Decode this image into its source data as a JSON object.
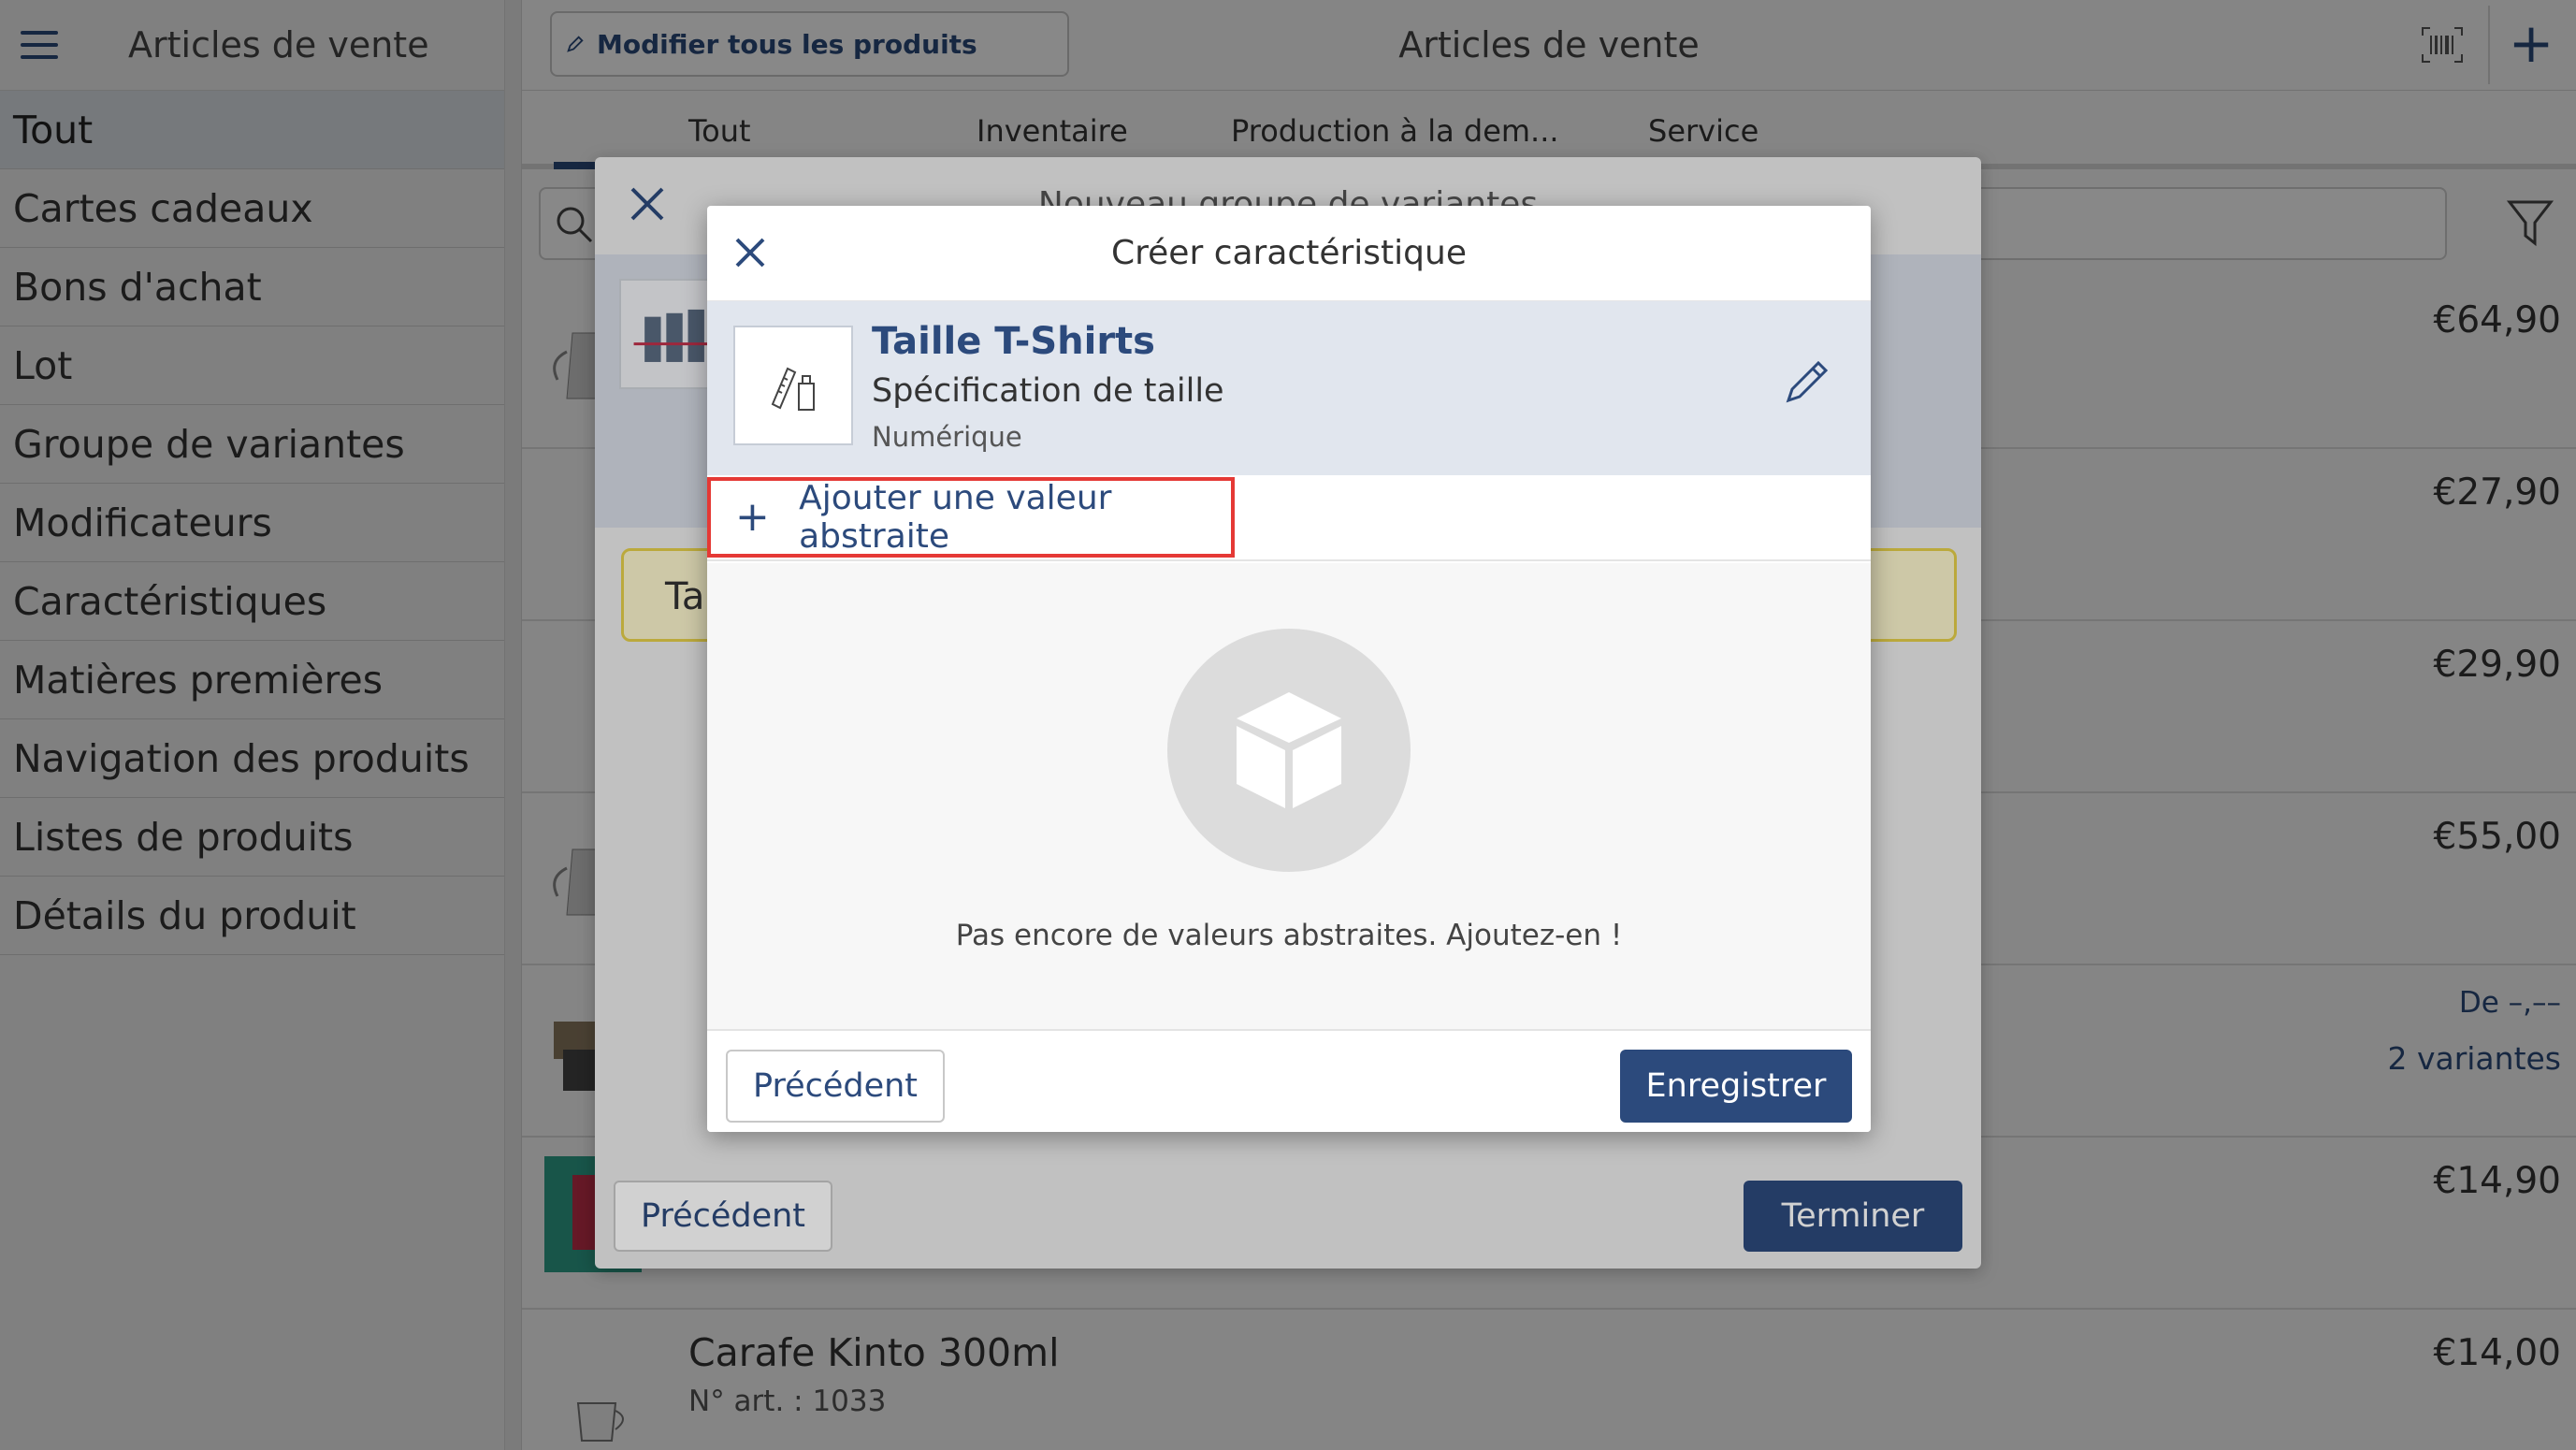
{
  "sidebar": {
    "title": "Articles de vente",
    "items": [
      {
        "label": "Tout"
      },
      {
        "label": "Cartes cadeaux"
      },
      {
        "label": "Bons d'achat"
      },
      {
        "label": "Lot"
      },
      {
        "label": "Groupe de variantes"
      },
      {
        "label": "Modificateurs"
      },
      {
        "label": "Caractéristiques"
      },
      {
        "label": "Matières premières"
      },
      {
        "label": "Navigation des produits"
      },
      {
        "label": "Listes de produits"
      },
      {
        "label": "Détails du produit"
      }
    ]
  },
  "topbar": {
    "edit_all_label": "Modifier tous les produits",
    "title": "Articles de vente",
    "add_label": "+"
  },
  "tabs": [
    {
      "label": "Tout"
    },
    {
      "label": "Inventaire"
    },
    {
      "label": "Production à la dem..."
    },
    {
      "label": "Service"
    }
  ],
  "products": [
    {
      "price": "€64,90"
    },
    {
      "price": "€27,90"
    },
    {
      "price": "€29,90"
    },
    {
      "price": "€55,00"
    },
    {
      "price_from": "De –,––",
      "variants": "2 variantes"
    },
    {
      "price": "€14,90"
    },
    {
      "name": "Carafe Kinto 300ml",
      "art_no": "N° art. : 1033",
      "price": "€14,00"
    }
  ],
  "variant_dialog": {
    "title": "Nouveau groupe de variantes",
    "yellow_text": "Tai",
    "prev_label": "Précédent",
    "finish_label": "Terminer"
  },
  "dialog": {
    "title": "Créer caractéristique",
    "characteristic": {
      "name": "Taille T-Shirts",
      "description": "Spécification de taille",
      "type": "Numérique"
    },
    "add_value_label": "Ajouter une valeur abstraite",
    "empty_text": "Pas encore de valeurs abstraites. Ajoutez-en !",
    "prev_label": "Précédent",
    "save_label": "Enregistrer"
  },
  "colors": {
    "accent": "#2c4a7c",
    "highlight": "#e53935",
    "warning_bg": "#fbf5cc"
  }
}
